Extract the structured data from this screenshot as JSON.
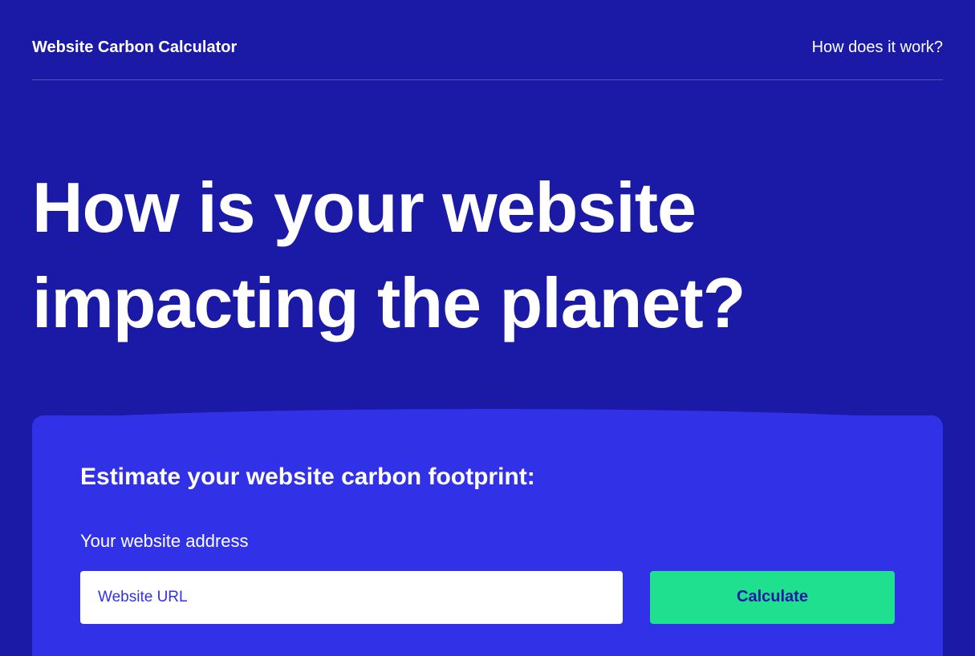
{
  "header": {
    "logo": "Website Carbon Calculator",
    "navLink": "How does it work?"
  },
  "hero": {
    "title": "How is your website impacting the planet?"
  },
  "form": {
    "title": "Estimate your website carbon footprint:",
    "label": "Your website address",
    "placeholder": "Website URL",
    "buttonLabel": "Calculate"
  }
}
